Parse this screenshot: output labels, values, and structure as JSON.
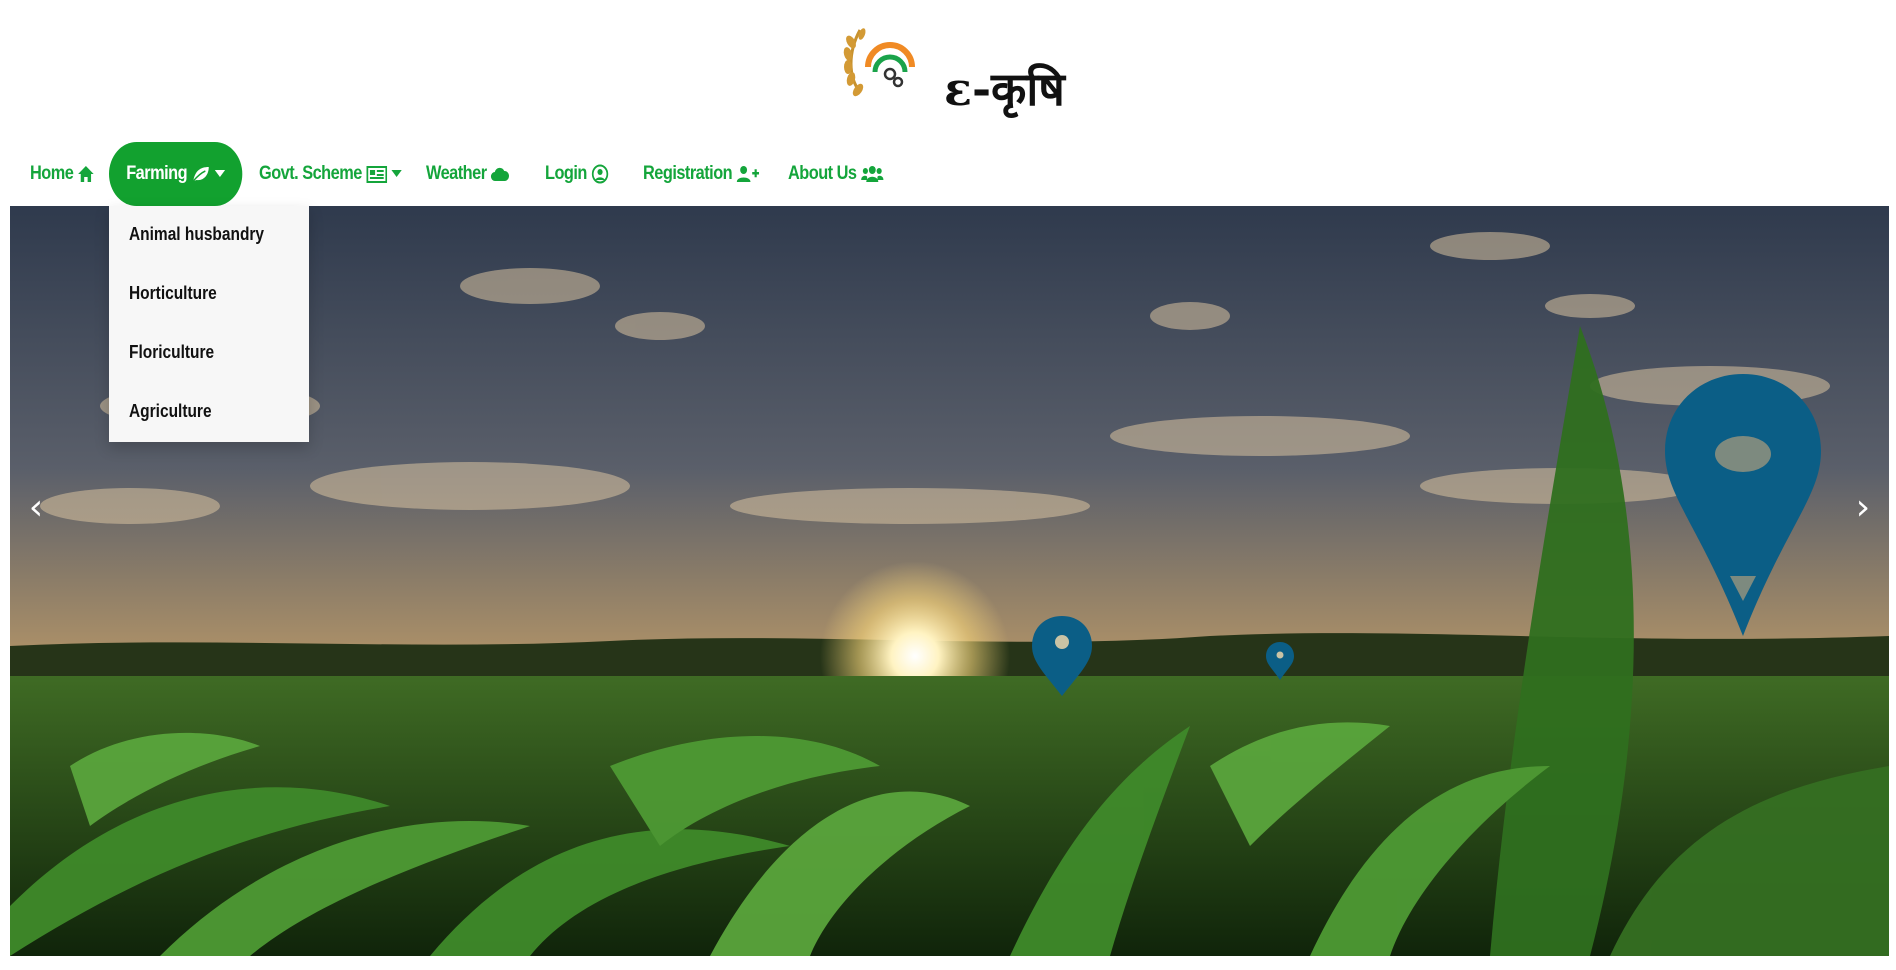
{
  "site": {
    "title": "ε-कृषि"
  },
  "nav": {
    "items": [
      {
        "label": "Home",
        "icon": "home-icon"
      },
      {
        "label": "Farming",
        "icon": "leaf-icon",
        "active": true,
        "has_dropdown": true
      },
      {
        "label": "Govt. Scheme",
        "icon": "newspaper-icon",
        "has_dropdown": true
      },
      {
        "label": "Weather",
        "icon": "cloud-icon"
      },
      {
        "label": "Login",
        "icon": "user-circle-icon"
      },
      {
        "label": "Registration",
        "icon": "user-plus-icon"
      },
      {
        "label": "About Us",
        "icon": "users-icon"
      }
    ]
  },
  "dropdown": {
    "items": [
      "Animal husbandry",
      "Horticulture",
      "Floriculture",
      "Agriculture"
    ]
  },
  "carousel": {
    "prev": "‹",
    "next": "›"
  },
  "colors": {
    "brand_green": "#14a53b",
    "active_bg": "#12a12f",
    "pin_blue": "#0b5e86"
  }
}
